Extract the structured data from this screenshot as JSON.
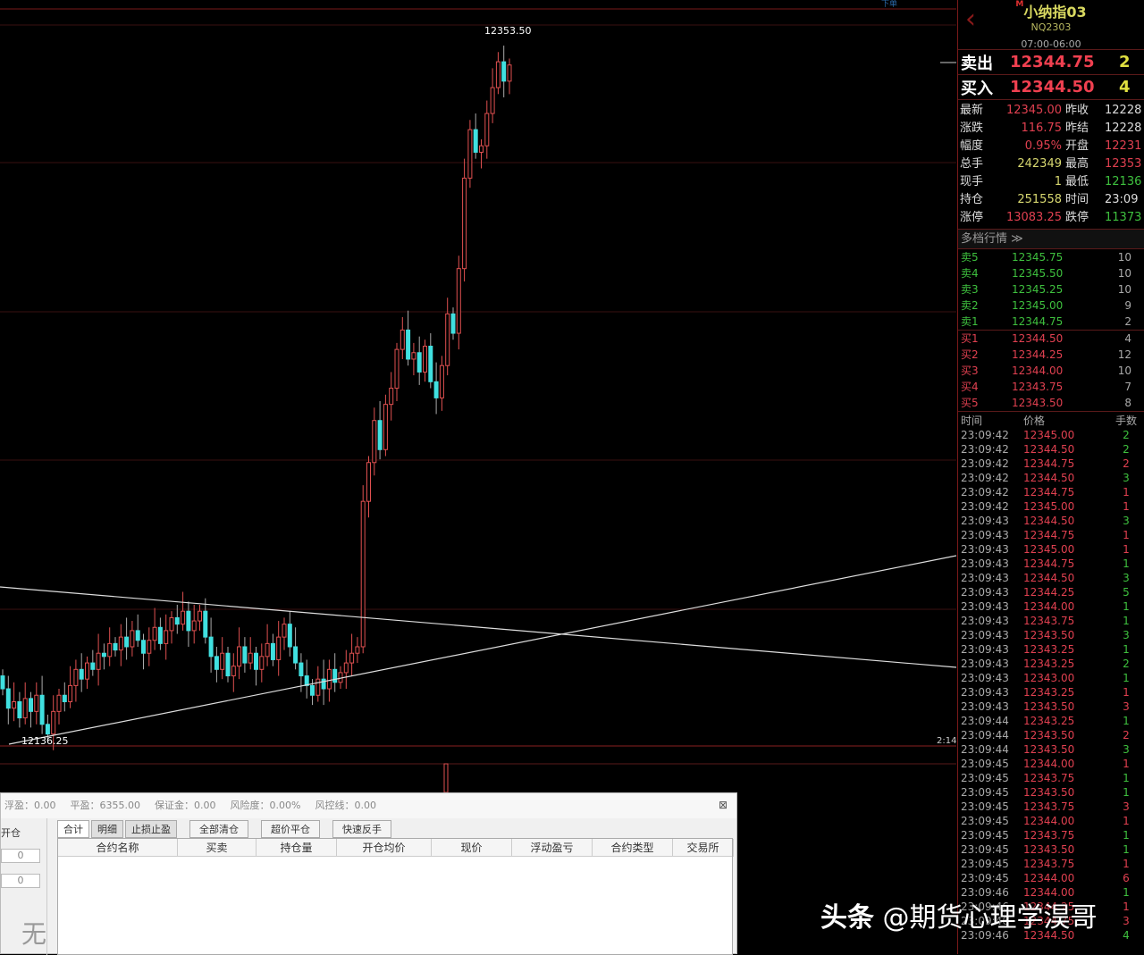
{
  "chart": {
    "high_label": "12353.50",
    "low_label": "12136.25",
    "time_label": "2:14",
    "corner_label": "下单",
    "closes": [
      12152,
      12146,
      12148,
      12143,
      12149,
      12145,
      12150,
      12141,
      12138,
      12145,
      12150,
      12148,
      12153,
      12158,
      12155,
      12160,
      12158,
      12163,
      12162,
      12166,
      12164,
      12168,
      12165,
      12170,
      12167,
      12163,
      12167,
      12171,
      12166,
      12170,
      12174,
      12172,
      12176,
      12170,
      12173,
      12176,
      12168,
      12162,
      12158,
      12163,
      12156,
      12159,
      12165,
      12160,
      12163,
      12158,
      12162,
      12166,
      12161,
      12168,
      12172,
      12165,
      12160,
      12156,
      12153,
      12150,
      12155,
      12152,
      12158,
      12154,
      12157,
      12160,
      12163,
      12165,
      12210,
      12222,
      12235,
      12226,
      12240,
      12245,
      12257,
      12263,
      12254,
      12256,
      12250,
      12258,
      12247,
      12242,
      12252,
      12268,
      12262,
      12282,
      12310,
      12325,
      12318,
      12320,
      12330,
      12338,
      12346,
      12340,
      12345
    ],
    "price_max": 12353.5,
    "price_min": 12136.25,
    "up_color": "#e05050",
    "down_color": "#40e0e0"
  },
  "panel": {
    "title": "小纳指03",
    "badge": "M",
    "code": "NQ2303",
    "session": "07:00-06:00",
    "sell_label": "卖出",
    "sell_price": "12344.75",
    "sell_vol": "2",
    "buy_label": "买入",
    "buy_price": "12344.50",
    "buy_vol": "4",
    "quote": [
      [
        "最新",
        "12345.00",
        "昨收",
        "12228"
      ],
      [
        "涨跌",
        "116.75",
        "昨结",
        "12228"
      ],
      [
        "幅度",
        "0.95%",
        "开盘",
        "12231"
      ],
      [
        "总手",
        "242349",
        "最高",
        "12353"
      ],
      [
        "现手",
        "1",
        "最低",
        "12136"
      ],
      [
        "持仓",
        "251558",
        "时间",
        "23:09"
      ],
      [
        "涨停",
        "13083.25",
        "跌停",
        "11373"
      ]
    ],
    "depth_title": "多档行情 ≫",
    "asks": [
      [
        "卖5",
        "12345.75",
        "10"
      ],
      [
        "卖4",
        "12345.50",
        "10"
      ],
      [
        "卖3",
        "12345.25",
        "10"
      ],
      [
        "卖2",
        "12345.00",
        "9"
      ],
      [
        "卖1",
        "12344.75",
        "2"
      ]
    ],
    "bids": [
      [
        "买1",
        "12344.50",
        "4"
      ],
      [
        "买2",
        "12344.25",
        "12"
      ],
      [
        "买3",
        "12344.00",
        "10"
      ],
      [
        "买4",
        "12343.75",
        "7"
      ],
      [
        "买5",
        "12343.50",
        "8"
      ]
    ],
    "tick_headers": [
      "时间",
      "价格",
      "手数"
    ],
    "ticks": [
      [
        "23:09:42",
        "12345.00",
        "2",
        "g"
      ],
      [
        "23:09:42",
        "12344.50",
        "2",
        "g"
      ],
      [
        "23:09:42",
        "12344.75",
        "2",
        "r"
      ],
      [
        "23:09:42",
        "12344.50",
        "3",
        "g"
      ],
      [
        "23:09:42",
        "12344.75",
        "1",
        "r"
      ],
      [
        "23:09:42",
        "12345.00",
        "1",
        "r"
      ],
      [
        "23:09:43",
        "12344.50",
        "3",
        "g"
      ],
      [
        "23:09:43",
        "12344.75",
        "1",
        "r"
      ],
      [
        "23:09:43",
        "12345.00",
        "1",
        "r"
      ],
      [
        "23:09:43",
        "12344.75",
        "1",
        "g"
      ],
      [
        "23:09:43",
        "12344.50",
        "3",
        "g"
      ],
      [
        "23:09:43",
        "12344.25",
        "5",
        "g"
      ],
      [
        "23:09:43",
        "12344.00",
        "1",
        "g"
      ],
      [
        "23:09:43",
        "12343.75",
        "1",
        "g"
      ],
      [
        "23:09:43",
        "12343.50",
        "3",
        "g"
      ],
      [
        "23:09:43",
        "12343.25",
        "1",
        "g"
      ],
      [
        "23:09:43",
        "12343.25",
        "2",
        "g"
      ],
      [
        "23:09:43",
        "12343.00",
        "1",
        "g"
      ],
      [
        "23:09:43",
        "12343.25",
        "1",
        "r"
      ],
      [
        "23:09:43",
        "12343.50",
        "3",
        "r"
      ],
      [
        "23:09:44",
        "12343.25",
        "1",
        "g"
      ],
      [
        "23:09:44",
        "12343.50",
        "2",
        "r"
      ],
      [
        "23:09:44",
        "12343.50",
        "3",
        "g"
      ],
      [
        "23:09:45",
        "12344.00",
        "1",
        "r"
      ],
      [
        "23:09:45",
        "12343.75",
        "1",
        "g"
      ],
      [
        "23:09:45",
        "12343.50",
        "1",
        "g"
      ],
      [
        "23:09:45",
        "12343.75",
        "3",
        "r"
      ],
      [
        "23:09:45",
        "12344.00",
        "1",
        "r"
      ],
      [
        "23:09:45",
        "12343.75",
        "1",
        "g"
      ],
      [
        "23:09:45",
        "12343.50",
        "1",
        "g"
      ],
      [
        "23:09:45",
        "12343.75",
        "1",
        "r"
      ],
      [
        "23:09:45",
        "12344.00",
        "6",
        "r"
      ],
      [
        "23:09:46",
        "12344.00",
        "1",
        "g"
      ],
      [
        "23:09:46",
        "12344.25",
        "1",
        "r"
      ],
      [
        "23:09:46",
        "12344.75",
        "3",
        "r"
      ],
      [
        "23:09:46",
        "12344.50",
        "4",
        "g"
      ]
    ]
  },
  "account": {
    "items": [
      "浮盈：0.00",
      "平盈：6355.00",
      "保证金：0.00",
      "风险度：0.00%",
      "风控线：0.00"
    ],
    "close": "⊠",
    "left_label": "开仓",
    "spin1": "0",
    "spin2": "0",
    "big_char": "无",
    "tabs": [
      "合计",
      "明细",
      "止损止盈"
    ],
    "buttons": [
      "全部清仓",
      "超价平仓",
      "快速反手"
    ],
    "columns": [
      "合约名称",
      "买卖",
      "持仓量",
      "开仓均价",
      "现价",
      "浮动盈亏",
      "合约类型",
      "交易所"
    ]
  },
  "watermark": {
    "brand": "头条",
    "handle": "@期货心理学淏哥"
  }
}
